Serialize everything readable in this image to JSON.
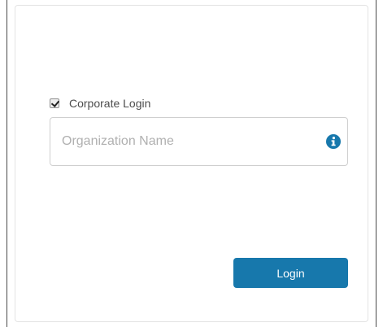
{
  "corporate_login": {
    "checked": true,
    "label": "Corporate Login"
  },
  "organization_field": {
    "value": "",
    "placeholder": "Organization Name",
    "info_icon": "info-circle-icon"
  },
  "login_button": {
    "label": "Login"
  },
  "colors": {
    "primary_button": "#1778ac",
    "info_icon": "#1778ac",
    "panel_border": "#e3e3e3",
    "placeholder_text": "#b0b0b0",
    "label_text": "#4d4d4d"
  }
}
